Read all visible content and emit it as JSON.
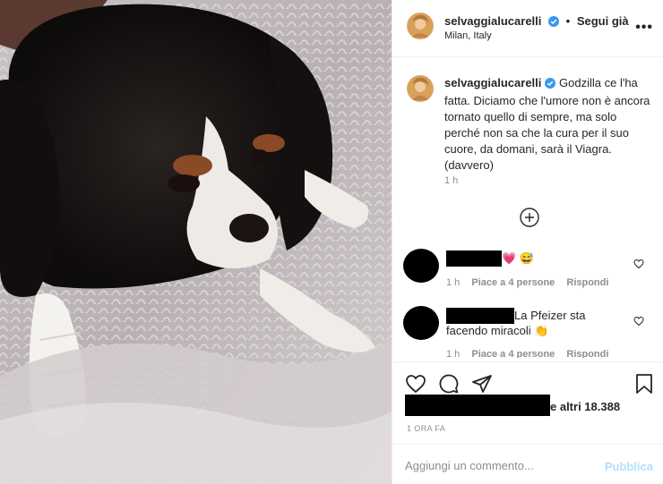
{
  "header": {
    "username": "selvaggialucarelli",
    "follow_label": "Segui già",
    "location": "Milan, Italy",
    "more_label": "•••"
  },
  "caption": {
    "username": "selvaggialucarelli",
    "text": "Godzilla ce l'ha fatta. Diciamo che l'umore non è ancora tornato quello di sempre, ma solo perché non sa che la cura per il suo cuore, da domani, sarà il Viagra. (davvero)",
    "time": "1 h"
  },
  "comments": [
    {
      "text": "💗 😅",
      "time": "1 h",
      "likes": "Piace a 4 persone",
      "reply": "Rispondi"
    },
    {
      "text_line1": "La Pfeizer sta",
      "text_line2": "facendo miracoli 👏",
      "time": "1 h",
      "likes": "Piace a 4 persone",
      "reply": "Rispondi"
    }
  ],
  "likes": {
    "text": "e altri 18.388"
  },
  "post_time": "1 ORA FA",
  "add_comment": {
    "placeholder": "Aggiungi un commento...",
    "publish_label": "Pubblica"
  },
  "icons": {
    "verified": "verified-badge-icon",
    "more": "more-options-icon",
    "load_more": "plus-circle-icon",
    "like": "heart-icon",
    "comment": "comment-bubble-icon",
    "share": "paper-plane-icon",
    "save": "bookmark-icon"
  },
  "colors": {
    "verified_blue": "#3897f0",
    "publish_disabled": "#b2dffc",
    "muted_text": "#8e8e8e"
  }
}
